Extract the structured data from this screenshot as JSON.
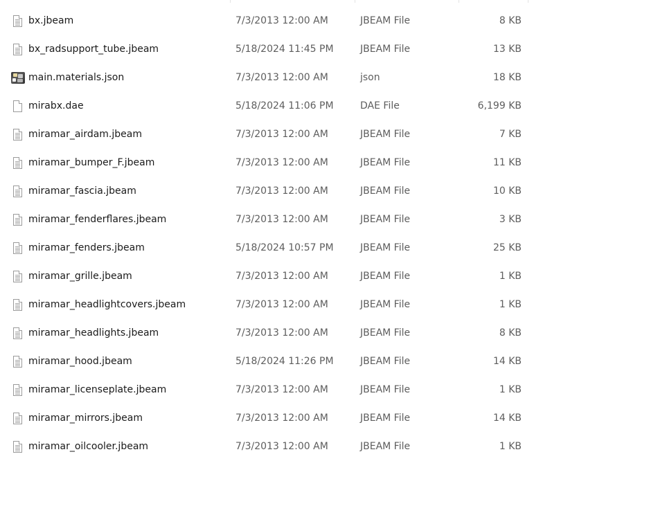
{
  "files": [
    {
      "name": "bx.jbeam",
      "date": "7/3/2013 12:00 AM",
      "type": "JBEAM File",
      "size": "8 KB",
      "icon": "document-icon"
    },
    {
      "name": "bx_radsupport_tube.jbeam",
      "date": "5/18/2024 11:45 PM",
      "type": "JBEAM File",
      "size": "13 KB",
      "icon": "document-icon"
    },
    {
      "name": "main.materials.json",
      "date": "7/3/2013 12:00 AM",
      "type": "json",
      "size": "18 KB",
      "icon": "image-thumbnail-icon"
    },
    {
      "name": "mirabx.dae",
      "date": "5/18/2024 11:06 PM",
      "type": "DAE File",
      "size": "6,199 KB",
      "icon": "blank-file-icon"
    },
    {
      "name": "miramar_airdam.jbeam",
      "date": "7/3/2013 12:00 AM",
      "type": "JBEAM File",
      "size": "7 KB",
      "icon": "document-icon"
    },
    {
      "name": "miramar_bumper_F.jbeam",
      "date": "7/3/2013 12:00 AM",
      "type": "JBEAM File",
      "size": "11 KB",
      "icon": "document-icon"
    },
    {
      "name": "miramar_fascia.jbeam",
      "date": "7/3/2013 12:00 AM",
      "type": "JBEAM File",
      "size": "10 KB",
      "icon": "document-icon"
    },
    {
      "name": "miramar_fenderflares.jbeam",
      "date": "7/3/2013 12:00 AM",
      "type": "JBEAM File",
      "size": "3 KB",
      "icon": "document-icon"
    },
    {
      "name": "miramar_fenders.jbeam",
      "date": "5/18/2024 10:57 PM",
      "type": "JBEAM File",
      "size": "25 KB",
      "icon": "document-icon"
    },
    {
      "name": "miramar_grille.jbeam",
      "date": "7/3/2013 12:00 AM",
      "type": "JBEAM File",
      "size": "1 KB",
      "icon": "document-icon"
    },
    {
      "name": "miramar_headlightcovers.jbeam",
      "date": "7/3/2013 12:00 AM",
      "type": "JBEAM File",
      "size": "1 KB",
      "icon": "document-icon"
    },
    {
      "name": "miramar_headlights.jbeam",
      "date": "7/3/2013 12:00 AM",
      "type": "JBEAM File",
      "size": "8 KB",
      "icon": "document-icon"
    },
    {
      "name": "miramar_hood.jbeam",
      "date": "5/18/2024 11:26 PM",
      "type": "JBEAM File",
      "size": "14 KB",
      "icon": "document-icon"
    },
    {
      "name": "miramar_licenseplate.jbeam",
      "date": "7/3/2013 12:00 AM",
      "type": "JBEAM File",
      "size": "1 KB",
      "icon": "document-icon"
    },
    {
      "name": "miramar_mirrors.jbeam",
      "date": "7/3/2013 12:00 AM",
      "type": "JBEAM File",
      "size": "14 KB",
      "icon": "document-icon"
    },
    {
      "name": "miramar_oilcooler.jbeam",
      "date": "7/3/2013 12:00 AM",
      "type": "JBEAM File",
      "size": "1 KB",
      "icon": "document-icon"
    }
  ]
}
